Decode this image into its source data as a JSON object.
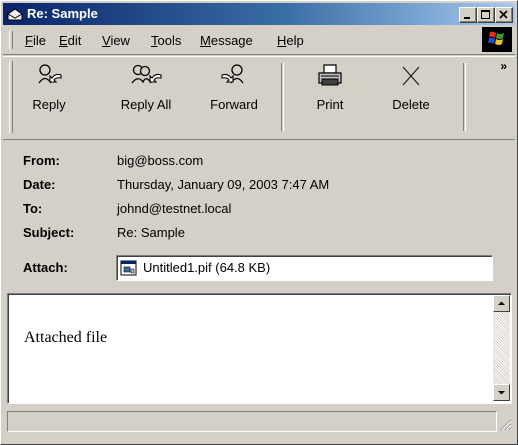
{
  "window": {
    "title": "Re: Sample"
  },
  "menu": [
    {
      "label": "File",
      "key": "F",
      "rest": "ile"
    },
    {
      "label": "Edit",
      "key": "E",
      "rest": "dit"
    },
    {
      "label": "View",
      "key": "V",
      "rest": "iew"
    },
    {
      "label": "Tools",
      "key": "T",
      "rest": "ools"
    },
    {
      "label": "Message",
      "key": "M",
      "rest": "essage"
    },
    {
      "label": "Help",
      "key": "H",
      "rest": "elp"
    }
  ],
  "toolbar": {
    "reply": "Reply",
    "reply_all": "Reply All",
    "forward": "Forward",
    "print": "Print",
    "delete": "Delete",
    "more": "»"
  },
  "header": {
    "from_label": "From:",
    "from_value": "big@boss.com",
    "date_label": "Date:",
    "date_value": "Thursday, January 09, 2003 7:47 AM",
    "to_label": "To:",
    "to_value": "johnd@testnet.local",
    "subject_label": "Subject:",
    "subject_value": "Re: Sample",
    "attach_label": "Attach:",
    "attachment": "Untitled1.pif (64.8 KB)"
  },
  "body": {
    "text": "Attached file"
  },
  "icons": {
    "window": "envelope-icon",
    "minimize": "minimize-icon",
    "maximize": "maximize-icon",
    "close": "close-icon",
    "brand": "windows-logo-icon",
    "reply": "reply-icon",
    "reply_all": "reply-all-icon",
    "forward": "forward-icon",
    "print": "printer-icon",
    "delete": "delete-x-icon",
    "attachment": "pif-file-icon"
  },
  "colors": {
    "titlebar_start": "#0a246a",
    "titlebar_end": "#a6caf0",
    "face": "#d4d0c8"
  }
}
